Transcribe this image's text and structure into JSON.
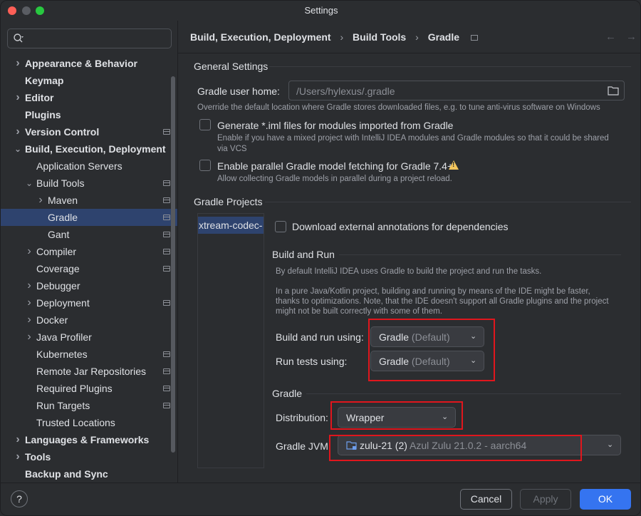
{
  "window": {
    "title": "Settings"
  },
  "search": {
    "placeholder": ""
  },
  "tree": [
    {
      "label": "Appearance & Behavior",
      "bold": true,
      "depth": 0,
      "arrow": "right",
      "proj": false,
      "selected": false,
      "name": "tree-item-appearance-behavior"
    },
    {
      "label": "Keymap",
      "bold": true,
      "depth": 0,
      "arrow": "",
      "proj": false,
      "selected": false,
      "name": "tree-item-keymap"
    },
    {
      "label": "Editor",
      "bold": true,
      "depth": 0,
      "arrow": "right",
      "proj": false,
      "selected": false,
      "name": "tree-item-editor"
    },
    {
      "label": "Plugins",
      "bold": true,
      "depth": 0,
      "arrow": "",
      "proj": false,
      "selected": false,
      "name": "tree-item-plugins"
    },
    {
      "label": "Version Control",
      "bold": true,
      "depth": 0,
      "arrow": "right",
      "proj": true,
      "selected": false,
      "name": "tree-item-version-control"
    },
    {
      "label": "Build, Execution, Deployment",
      "bold": true,
      "depth": 0,
      "arrow": "down",
      "proj": false,
      "selected": false,
      "name": "tree-item-build-execution-deployment"
    },
    {
      "label": "Application Servers",
      "bold": false,
      "depth": 1,
      "arrow": "",
      "proj": false,
      "selected": false,
      "name": "tree-item-application-servers"
    },
    {
      "label": "Build Tools",
      "bold": false,
      "depth": 1,
      "arrow": "down",
      "proj": true,
      "selected": false,
      "name": "tree-item-build-tools"
    },
    {
      "label": "Maven",
      "bold": false,
      "depth": 2,
      "arrow": "right",
      "proj": true,
      "selected": false,
      "name": "tree-item-maven"
    },
    {
      "label": "Gradle",
      "bold": false,
      "depth": 2,
      "arrow": "",
      "proj": true,
      "selected": true,
      "name": "tree-item-gradle"
    },
    {
      "label": "Gant",
      "bold": false,
      "depth": 2,
      "arrow": "",
      "proj": true,
      "selected": false,
      "name": "tree-item-gant"
    },
    {
      "label": "Compiler",
      "bold": false,
      "depth": 1,
      "arrow": "right",
      "proj": true,
      "selected": false,
      "name": "tree-item-compiler"
    },
    {
      "label": "Coverage",
      "bold": false,
      "depth": 1,
      "arrow": "",
      "proj": true,
      "selected": false,
      "name": "tree-item-coverage"
    },
    {
      "label": "Debugger",
      "bold": false,
      "depth": 1,
      "arrow": "right",
      "proj": false,
      "selected": false,
      "name": "tree-item-debugger"
    },
    {
      "label": "Deployment",
      "bold": false,
      "depth": 1,
      "arrow": "right",
      "proj": true,
      "selected": false,
      "name": "tree-item-deployment"
    },
    {
      "label": "Docker",
      "bold": false,
      "depth": 1,
      "arrow": "right",
      "proj": false,
      "selected": false,
      "name": "tree-item-docker"
    },
    {
      "label": "Java Profiler",
      "bold": false,
      "depth": 1,
      "arrow": "right",
      "proj": false,
      "selected": false,
      "name": "tree-item-java-profiler"
    },
    {
      "label": "Kubernetes",
      "bold": false,
      "depth": 1,
      "arrow": "",
      "proj": true,
      "selected": false,
      "name": "tree-item-kubernetes"
    },
    {
      "label": "Remote Jar Repositories",
      "bold": false,
      "depth": 1,
      "arrow": "",
      "proj": true,
      "selected": false,
      "name": "tree-item-remote-jar-repositories"
    },
    {
      "label": "Required Plugins",
      "bold": false,
      "depth": 1,
      "arrow": "",
      "proj": true,
      "selected": false,
      "name": "tree-item-required-plugins"
    },
    {
      "label": "Run Targets",
      "bold": false,
      "depth": 1,
      "arrow": "",
      "proj": true,
      "selected": false,
      "name": "tree-item-run-targets"
    },
    {
      "label": "Trusted Locations",
      "bold": false,
      "depth": 1,
      "arrow": "",
      "proj": false,
      "selected": false,
      "name": "tree-item-trusted-locations"
    },
    {
      "label": "Languages & Frameworks",
      "bold": true,
      "depth": 0,
      "arrow": "right",
      "proj": false,
      "selected": false,
      "name": "tree-item-languages-frameworks"
    },
    {
      "label": "Tools",
      "bold": true,
      "depth": 0,
      "arrow": "right",
      "proj": false,
      "selected": false,
      "name": "tree-item-tools"
    },
    {
      "label": "Backup and Sync",
      "bold": true,
      "depth": 0,
      "arrow": "",
      "proj": false,
      "selected": false,
      "name": "tree-item-backup-and-sync"
    }
  ],
  "breadcrumb": {
    "part1": "Build, Execution, Deployment",
    "part2": "Build Tools",
    "part3": "Gradle",
    "sep": "›"
  },
  "nav": {
    "back": "←",
    "forward": "→"
  },
  "general": {
    "title": "General Settings",
    "user_home_label": "Gradle user home:",
    "user_home_value": "/Users/hylexus/.gradle",
    "user_home_hint": "Override the default location where Gradle stores downloaded files, e.g. to tune anti-virus software on Windows",
    "iml_label": "Generate *.iml files for modules imported from Gradle",
    "iml_hint_1": "Enable if you have a mixed project with IntelliJ IDEA modules and Gradle modules so that it could be shared",
    "iml_hint_2": "via VCS",
    "parallel_label": "Enable parallel Gradle model fetching for Gradle 7.4+",
    "parallel_hint": "Allow collecting Gradle models in parallel during a project reload."
  },
  "projects": {
    "title": "Gradle Projects",
    "list_item": "xtream-codec-",
    "download_label": "Download external annotations for dependencies",
    "build_run_title": "Build and Run",
    "build_run_hint_1": "By default IntelliJ IDEA uses Gradle to build the project and run the tasks.",
    "build_run_hint_2": "In a pure Java/Kotlin project, building and running by means of the IDE might be faster,",
    "build_run_hint_3": "thanks to optimizations. Note, that the IDE doesn't support all Gradle plugins and the project",
    "build_run_hint_4": "might not be built correctly with some of them.",
    "build_using_label": "Build and run using:",
    "build_using_value": "Gradle",
    "build_using_suffix": "(Default)",
    "tests_using_label": "Run tests using:",
    "tests_using_value": "Gradle",
    "tests_using_suffix": "(Default)",
    "gradle_title": "Gradle",
    "distribution_label": "Distribution:",
    "distribution_value": "Wrapper",
    "jvm_label": "Gradle JVM:",
    "jvm_value": "zulu-21 (2)",
    "jvm_detail": "Azul Zulu 21.0.2 - aarch64"
  },
  "footer": {
    "help": "?",
    "cancel": "Cancel",
    "apply": "Apply",
    "ok": "OK"
  },
  "colors": {
    "accent": "#3574f0",
    "selection": "#2e436e",
    "highlight_box": "#e0161d",
    "warning": "#f2c55c"
  }
}
